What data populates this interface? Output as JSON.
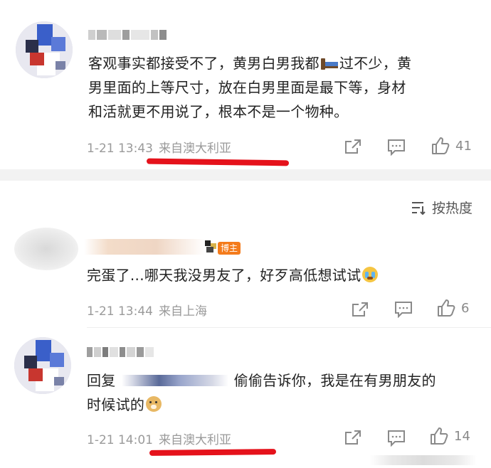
{
  "comment1": {
    "text": "客观事实都接受不了，黄男白男我都🛏️过不少，黄男里面的上等尺寸，放在白男里面是最下等，身材和活就更不用说了，根本不是一个物种。",
    "line1": "客观事实都接受不了，黄男白男我都",
    "line1b": "过不少，黄",
    "line2": "男里面的上等尺寸，放在白男里面是最下等，身材",
    "line3": "和活就更不用说了，根本不是一个物种。",
    "time": "1-21 13:43",
    "location": "来自澳大利亚",
    "likes": "41"
  },
  "sort": {
    "label": "按热度"
  },
  "comment2": {
    "badge": "博主",
    "text": "完蛋了...哪天我没男友了，好歹高低想试试",
    "time": "1-21 13:44",
    "location": "来自上海",
    "likes": "6"
  },
  "comment3": {
    "reply_prefix": "回复",
    "line1": "偷偷告诉你，我是在有男朋友的",
    "line2": "时候试的",
    "time": "1-21 14:01",
    "location": "来自澳大利亚",
    "likes": "14"
  },
  "colors": {
    "highlight": "#e5121b",
    "meta": "#9a9a9a",
    "badge": "#f47b1b"
  },
  "icons": [
    "share-icon",
    "comment-icon",
    "like-icon",
    "sort-icon",
    "bed-emoji",
    "crying-emoji",
    "doge-emoji"
  ]
}
